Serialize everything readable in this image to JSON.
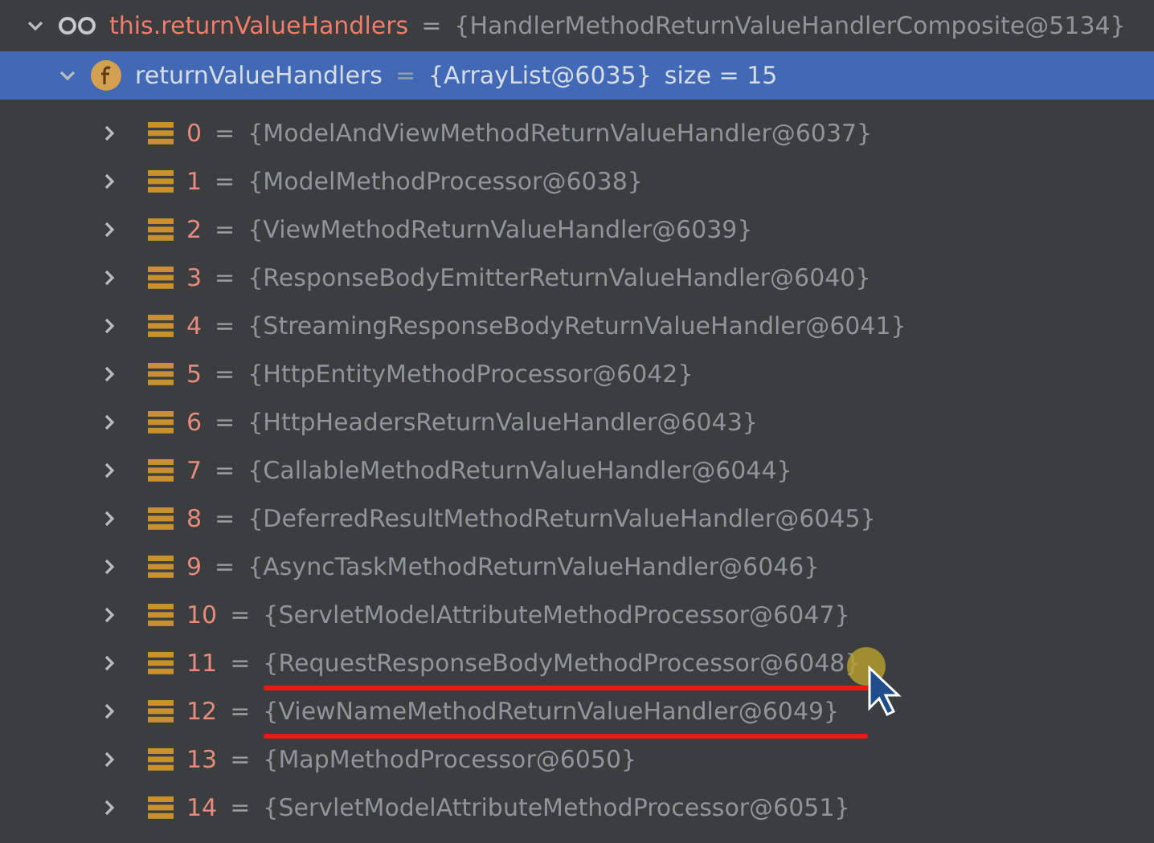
{
  "root": {
    "name": "this.returnValueHandlers",
    "equals": "=",
    "value": "{HandlerMethodReturnValueHandlerComposite@5134}",
    "expanded": true,
    "child": {
      "name": "returnValueHandlers",
      "equals": "=",
      "value": "{ArrayList@6035}",
      "size": "size = 15",
      "expanded": true,
      "selected": true,
      "items": [
        {
          "index": "0",
          "equals": "=",
          "value": "{ModelAndViewMethodReturnValueHandler@6037}",
          "expanded": false,
          "underlined": false
        },
        {
          "index": "1",
          "equals": "=",
          "value": "{ModelMethodProcessor@6038}",
          "expanded": false,
          "underlined": false
        },
        {
          "index": "2",
          "equals": "=",
          "value": "{ViewMethodReturnValueHandler@6039}",
          "expanded": false,
          "underlined": false
        },
        {
          "index": "3",
          "equals": "=",
          "value": "{ResponseBodyEmitterReturnValueHandler@6040}",
          "expanded": false,
          "underlined": false
        },
        {
          "index": "4",
          "equals": "=",
          "value": "{StreamingResponseBodyReturnValueHandler@6041}",
          "expanded": false,
          "underlined": false
        },
        {
          "index": "5",
          "equals": "=",
          "value": "{HttpEntityMethodProcessor@6042}",
          "expanded": false,
          "underlined": false
        },
        {
          "index": "6",
          "equals": "=",
          "value": "{HttpHeadersReturnValueHandler@6043}",
          "expanded": false,
          "underlined": false
        },
        {
          "index": "7",
          "equals": "=",
          "value": "{CallableMethodReturnValueHandler@6044}",
          "expanded": false,
          "underlined": false
        },
        {
          "index": "8",
          "equals": "=",
          "value": "{DeferredResultMethodReturnValueHandler@6045}",
          "expanded": false,
          "underlined": false
        },
        {
          "index": "9",
          "equals": "=",
          "value": "{AsyncTaskMethodReturnValueHandler@6046}",
          "expanded": false,
          "underlined": false
        },
        {
          "index": "10",
          "equals": "=",
          "value": "{ServletModelAttributeMethodProcessor@6047}",
          "expanded": false,
          "underlined": false
        },
        {
          "index": "11",
          "equals": "=",
          "value": "{RequestResponseBodyMethodProcessor@6048}",
          "expanded": false,
          "underlined": true
        },
        {
          "index": "12",
          "equals": "=",
          "value": "{ViewNameMethodReturnValueHandler@6049}",
          "expanded": false,
          "underlined": true
        },
        {
          "index": "13",
          "equals": "=",
          "value": "{MapMethodProcessor@6050}",
          "expanded": false,
          "underlined": false
        },
        {
          "index": "14",
          "equals": "=",
          "value": "{ServletModelAttributeMethodProcessor@6051}",
          "expanded": false,
          "underlined": false
        }
      ]
    }
  }
}
